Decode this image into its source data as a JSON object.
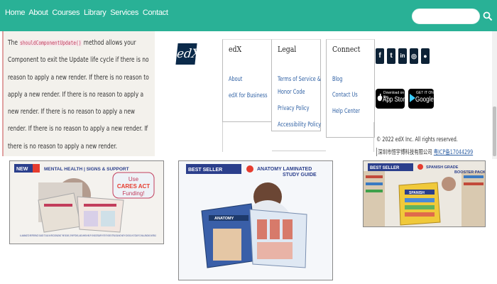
{
  "nav": {
    "links": [
      "Home",
      "About",
      "Courses",
      "Library",
      "Services",
      "Contact"
    ],
    "search_placeholder": ""
  },
  "article": {
    "prefix": "The ",
    "code": "shouldComponentUpdate()",
    "body": " method allows your Component to exit the Update life cycle if there is no reason to apply a new render. If there is no reason to apply a new render. If there is no reason to apply a new render. If there is no reason to apply a new render. If there is no reason to apply a new render. If there is no reason to apply a new render."
  },
  "logo": {
    "text": "edX"
  },
  "footer": {
    "columns": [
      {
        "title": "edX",
        "links": [
          "About",
          "edX for Business"
        ]
      },
      {
        "title": "Legal",
        "links": [
          "Terms of Service &",
          "Honor Code",
          "Privacy Policy",
          "Accessibility Policy"
        ]
      },
      {
        "title": "Connect",
        "links": [
          "Blog",
          "Contact Us",
          "Help Center"
        ]
      }
    ],
    "social_icons": [
      "facebook-icon",
      "twitter-icon",
      "linkedin-icon",
      "instagram-icon",
      "reddit-icon"
    ],
    "social_glyphs": [
      "f",
      "t",
      "in",
      "◎",
      "●"
    ],
    "app_store": {
      "small": "Download on the",
      "big": "App Store"
    },
    "google_play": {
      "small": "GET IT ON",
      "big": "Google Play"
    },
    "copyright": "© 2022 edX Inc. All rights reserved.",
    "icp_prefix": "深圳市恒宇博科技有限公司 ",
    "icp_link": "粤ICP备17044299"
  },
  "products": [
    {
      "tag": "NEW",
      "title": "MENTAL HEALTH | SIGNS & SUPPORT",
      "badge_line1": "Use",
      "badge_line2": "CARES ACT",
      "badge_line3": "Funding!",
      "caption": "A LAMINATED REFERENCE GUIDE TO AID IN RECOGNIZING THE SIGNS, SYMPTOMS, AND WHEN HELP IS NECESSARY FOR THOSE STRUGGLING WITH SCHOOL IN TODAY'S CHALLENGING WORLD"
    },
    {
      "tag": "BEST SELLER",
      "title_line1": "ANATOMY LAMINATED",
      "title_line2": "STUDY GUIDE",
      "book_label": "ANATOMY"
    },
    {
      "tag": "BEST SELLER",
      "title_line1": "SPANISH GRADE",
      "title_line2": "BOOSTER PACK",
      "book_label": "SPANISH"
    }
  ],
  "colors": {
    "nav_bg": "#29b196",
    "link": "#2d5fa3",
    "product_tag_bg": "#2b3f8c",
    "product_tag_accent": "#e63c2e"
  }
}
